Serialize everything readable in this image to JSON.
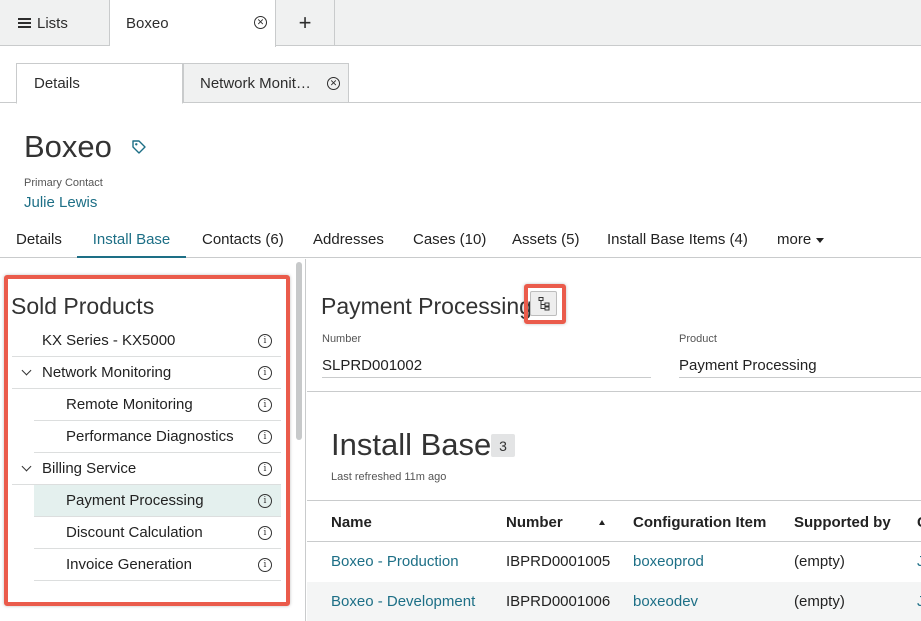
{
  "top_tabs": {
    "lists_label": "Lists",
    "boxeo_label": "Boxeo",
    "add_label": "+"
  },
  "sub_tabs": {
    "details_label": "Details",
    "network_label": "Network Monit…"
  },
  "record": {
    "title": "Boxeo",
    "primary_contact_label": "Primary Contact",
    "primary_contact_value": "Julie Lewis"
  },
  "record_tabs": [
    {
      "label": "Details"
    },
    {
      "label": "Install Base"
    },
    {
      "label": "Contacts (6)"
    },
    {
      "label": "Addresses"
    },
    {
      "label": "Cases (10)"
    },
    {
      "label": "Assets (5)"
    },
    {
      "label": "Install Base Items (4)"
    },
    {
      "label": "more"
    }
  ],
  "sold_products": {
    "title": "Sold Products",
    "items": [
      {
        "label": "KX Series - KX5000"
      },
      {
        "label": "Network Monitoring"
      },
      {
        "label": "Remote Monitoring"
      },
      {
        "label": "Performance Diagnostics"
      },
      {
        "label": "Billing Service"
      },
      {
        "label": "Payment Processing"
      },
      {
        "label": "Discount Calculation"
      },
      {
        "label": "Invoice Generation"
      }
    ]
  },
  "detail": {
    "title": "Payment Processing",
    "number_label": "Number",
    "number_value": "SLPRD001002",
    "product_label": "Product",
    "product_value": "Payment Processing"
  },
  "install_base": {
    "title": "Install Base",
    "count": "3",
    "refreshed": "Last refreshed 11m ago",
    "columns": [
      "Name",
      "Number",
      "Configuration Item",
      "Supported by",
      "C"
    ],
    "rows": [
      {
        "name": "Boxeo - Production",
        "number": "IBPRD0001005",
        "ci": "boxeoprod",
        "supported_by": "(empty)",
        "extra": "J"
      },
      {
        "name": "Boxeo - Development",
        "number": "IBPRD0001006",
        "ci": "boxeodev",
        "supported_by": "(empty)",
        "extra": "J"
      }
    ]
  },
  "colors": {
    "accent": "#1d6f86",
    "highlight": "#ea5b4b",
    "selected_row": "#e4f0ee"
  }
}
